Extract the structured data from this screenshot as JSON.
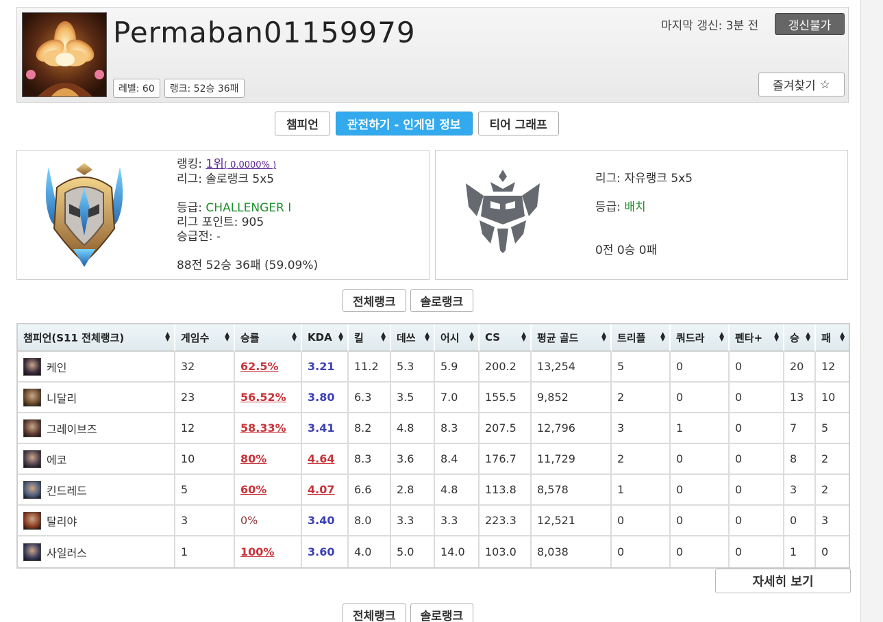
{
  "header": {
    "summoner_name": "Permaban01159979",
    "level_badge": "레벨: 60",
    "rank_badge": "랭크: 52승 36패",
    "last_update": "마지막 갱신: 3분 전",
    "update_button": "갱신불가",
    "favorite_button": "즐겨찾기",
    "favorite_icon": "☆"
  },
  "tabs": [
    {
      "label": "챔피언",
      "active": false
    },
    {
      "label": "관전하기 - 인게임 정보",
      "active": true
    },
    {
      "label": "티어 그래프",
      "active": false
    }
  ],
  "solo_rank": {
    "ranking_label": "랭킹: ",
    "ranking_value": "1위",
    "ranking_percent": "( 0.0000% )",
    "league": "리그: 솔로랭크 5x5",
    "tier_label": "등급: ",
    "tier_value": "CHALLENGER I",
    "league_points": "리그 포인트: 905",
    "promo": "승급전: -",
    "record": "88전 52승 36패 (59.09%)"
  },
  "flex_rank": {
    "league": "리그: 자유랭크 5x5",
    "tier_label": "등급: ",
    "tier_value": "배치",
    "record": "0전 0승 0패"
  },
  "filter_buttons": {
    "all": "전체랭크",
    "solo": "솔로랭크"
  },
  "table": {
    "headers": [
      "챔피언(S11 전체랭크)",
      "게임수",
      "승률",
      "KDA",
      "킬",
      "데쓰",
      "어시",
      "CS",
      "평균 골드",
      "트리플",
      "쿼드라",
      "펜타+",
      "승",
      "패"
    ],
    "rows": [
      {
        "champion": "케인",
        "games": "32",
        "winrate": "62.5%",
        "wr_style": "red",
        "kda": "3.21",
        "kda_style": "blue",
        "kills": "11.2",
        "deaths": "5.3",
        "assists": "5.9",
        "cs": "200.2",
        "gold": "13,254",
        "triple": "5",
        "quadra": "0",
        "penta": "0",
        "wins": "20",
        "losses": "12",
        "icon_color": "#3a2a3a"
      },
      {
        "champion": "니달리",
        "games": "23",
        "winrate": "56.52%",
        "wr_style": "red",
        "kda": "3.80",
        "kda_style": "blue",
        "kills": "6.3",
        "deaths": "3.5",
        "assists": "7.0",
        "cs": "155.5",
        "gold": "9,852",
        "triple": "2",
        "quadra": "0",
        "penta": "0",
        "wins": "13",
        "losses": "10",
        "icon_color": "#6b4a2a"
      },
      {
        "champion": "그레이브즈",
        "games": "12",
        "winrate": "58.33%",
        "wr_style": "red",
        "kda": "3.41",
        "kda_style": "blue",
        "kills": "8.2",
        "deaths": "4.8",
        "assists": "8.3",
        "cs": "207.5",
        "gold": "12,796",
        "triple": "3",
        "quadra": "1",
        "penta": "0",
        "wins": "7",
        "losses": "5",
        "icon_color": "#5a3a30"
      },
      {
        "champion": "에코",
        "games": "10",
        "winrate": "80%",
        "wr_style": "red",
        "kda": "4.64",
        "kda_style": "red",
        "kills": "8.3",
        "deaths": "3.6",
        "assists": "8.4",
        "cs": "176.7",
        "gold": "11,729",
        "triple": "2",
        "quadra": "0",
        "penta": "0",
        "wins": "8",
        "losses": "2",
        "icon_color": "#4a3a4a"
      },
      {
        "champion": "킨드레드",
        "games": "5",
        "winrate": "60%",
        "wr_style": "red",
        "kda": "4.07",
        "kda_style": "red",
        "kills": "6.6",
        "deaths": "2.8",
        "assists": "4.8",
        "cs": "113.8",
        "gold": "8,578",
        "triple": "1",
        "quadra": "0",
        "penta": "0",
        "wins": "3",
        "losses": "2",
        "icon_color": "#4a5a7a"
      },
      {
        "champion": "탈리야",
        "games": "3",
        "winrate": "0%",
        "wr_style": "plain",
        "kda": "3.40",
        "kda_style": "blue",
        "kills": "8.0",
        "deaths": "3.3",
        "assists": "3.3",
        "cs": "223.3",
        "gold": "12,521",
        "triple": "0",
        "quadra": "0",
        "penta": "0",
        "wins": "0",
        "losses": "3",
        "icon_color": "#8a3a20"
      },
      {
        "champion": "사일러스",
        "games": "1",
        "winrate": "100%",
        "wr_style": "red",
        "kda": "3.60",
        "kda_style": "blue",
        "kills": "4.0",
        "deaths": "5.0",
        "assists": "14.0",
        "cs": "103.0",
        "gold": "8,038",
        "triple": "0",
        "quadra": "0",
        "penta": "0",
        "wins": "1",
        "losses": "0",
        "icon_color": "#3a3a5a"
      }
    ]
  },
  "detail_button": "자세히 보기",
  "colors": {
    "accent_tab": "#33aaee",
    "challenger_green": "#1f8f2a",
    "winrate_red": "#c8333a",
    "kda_blue": "#3b3fb5"
  },
  "icons": {
    "avatar": "profile-icon-flower",
    "solo_emblem": "challenger-emblem-icon",
    "flex_emblem": "unranked-emblem-icon",
    "sort": "sort-arrows-icon"
  }
}
